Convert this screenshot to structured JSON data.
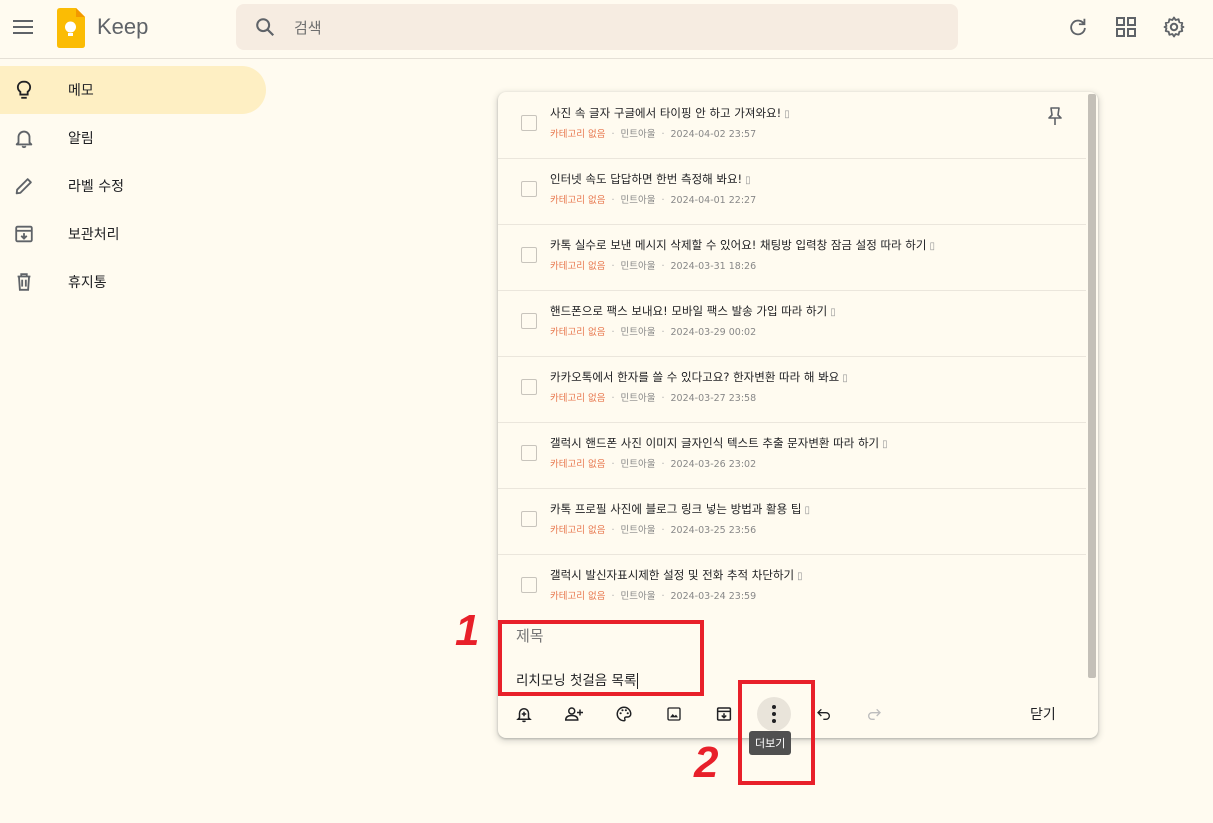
{
  "header": {
    "app_title": "Keep",
    "search_placeholder": "검색"
  },
  "sidebar": {
    "items": [
      {
        "label": "메모",
        "icon": "lightbulb-icon",
        "active": true
      },
      {
        "label": "알림",
        "icon": "bell-icon",
        "active": false
      },
      {
        "label": "라벨 수정",
        "icon": "pencil-icon",
        "active": false
      },
      {
        "label": "보관처리",
        "icon": "archive-icon",
        "active": false
      },
      {
        "label": "휴지통",
        "icon": "trash-icon",
        "active": false
      }
    ]
  },
  "note": {
    "items": [
      {
        "title": "사진 속 글자 구글에서 타이핑 안 하고 가져와요!",
        "category": "카테고리 없음",
        "author": "민트아울",
        "date": "2024-04-02 23:57"
      },
      {
        "title": "인터넷 속도 답답하면 한번 측정해 봐요!",
        "category": "카테고리 없음",
        "author": "민트아울",
        "date": "2024-04-01 22:27"
      },
      {
        "title": "카톡 실수로 보낸 메시지 삭제할 수 있어요! 채팅방 입력창 잠금 설정 따라 하기",
        "category": "카테고리 없음",
        "author": "민트아울",
        "date": "2024-03-31 18:26"
      },
      {
        "title": "핸드폰으로 팩스 보내요! 모바일 팩스 발송 가입 따라 하기",
        "category": "카테고리 없음",
        "author": "민트아울",
        "date": "2024-03-29 00:02"
      },
      {
        "title": "카카오톡에서 한자를 쓸 수 있다고요? 한자변환 따라 해 봐요",
        "category": "카테고리 없음",
        "author": "민트아울",
        "date": "2024-03-27 23:58"
      },
      {
        "title": "갤럭시 핸드폰 사진 이미지 글자인식 텍스트 추출 문자변환 따라 하기",
        "category": "카테고리 없음",
        "author": "민트아울",
        "date": "2024-03-26 23:02"
      },
      {
        "title": "카톡 프로필 사진에 블로그 링크 넣는 방법과 활용 팁",
        "category": "카테고리 없음",
        "author": "민트아울",
        "date": "2024-03-25 23:56"
      },
      {
        "title": "갤럭시 발신자표시제한 설정 및 전화 추적 차단하기",
        "category": "카테고리 없음",
        "author": "민트아울",
        "date": "2024-03-24 23:59"
      }
    ],
    "title_placeholder": "제목",
    "body_text": "리치모닝 첫걸음 목록",
    "close_label": "닫기",
    "more_tooltip": "더보기"
  },
  "annotations": {
    "label_1": "1",
    "label_2": "2",
    "highlight_color": "#e8202a"
  },
  "colors": {
    "background": "#fffbf0",
    "active_nav": "#feefc3",
    "category": "#e8784f"
  }
}
